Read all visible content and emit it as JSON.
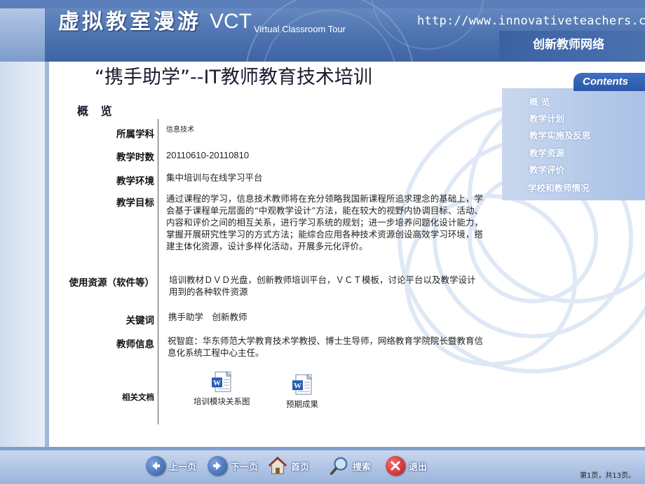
{
  "header": {
    "brand_cn": "虚拟教室漫游",
    "brand_vct": "VCT",
    "brand_sub": "Virtual Classroom Tour",
    "url": "http://www.innovativeteachers.cn",
    "network": "创新教师网络"
  },
  "title": "“携手助学”--IT教师教育技术培训",
  "overview": "概 览",
  "fields": [
    {
      "label": "所属学科",
      "value": "信息技术"
    },
    {
      "label": "教学时数",
      "value": "20110610-20110810"
    },
    {
      "label": "教学环境",
      "value": "集中培训与在线学习平台"
    },
    {
      "label": "教学目标",
      "value": "通过课程的学习，信息技术教师将在充分领略我国新课程所追求理念的基础上，学会基于课程单元层面的“中观教学设计”方法，能在较大的视野内协调目标、活动、内容和评价之间的相互关系，进行学习系统的规划；进一步培养问题化设计能力，掌握开展研究性学习的方式方法；能综合应用各种技术资源创设高效学习环境，搭建主体化资源，设计多样化活动，开展多元化评价。"
    },
    {
      "label": "使用资源（软件等）",
      "value": "培训教材ＤＶＤ光盘，创新教师培训平台，ＶＣＴ模板，讨论平台以及教学设计用到的各种软件资源"
    },
    {
      "label": "关键词",
      "value": "携手助学　创新教师"
    },
    {
      "label": "教师信息",
      "value": "祝智庭：华东师范大学教育技术学教授、博士生导师，网络教育学院院长暨教育信息化系统工程中心主任。"
    },
    {
      "label": "相关文档",
      "value": ""
    }
  ],
  "documents": [
    {
      "label": "培训模块关系图",
      "icon": "word-doc-icon"
    },
    {
      "label": "预期成果",
      "icon": "word-doc-icon"
    }
  ],
  "contents": {
    "title": "Contents",
    "items": [
      "概 览",
      "教学计划",
      "教学实施及反思",
      "教学资源",
      "教学评价",
      "学校和教师情况"
    ]
  },
  "bottom_nav": {
    "prev": "上一页",
    "next": "下一页",
    "home": "首页",
    "search": "搜索",
    "exit": "退出"
  },
  "page_info": "第1页，共13页。",
  "colors": {
    "header": "#4f74b0",
    "accent": "#2b58a8",
    "exit_red": "#d42020"
  }
}
